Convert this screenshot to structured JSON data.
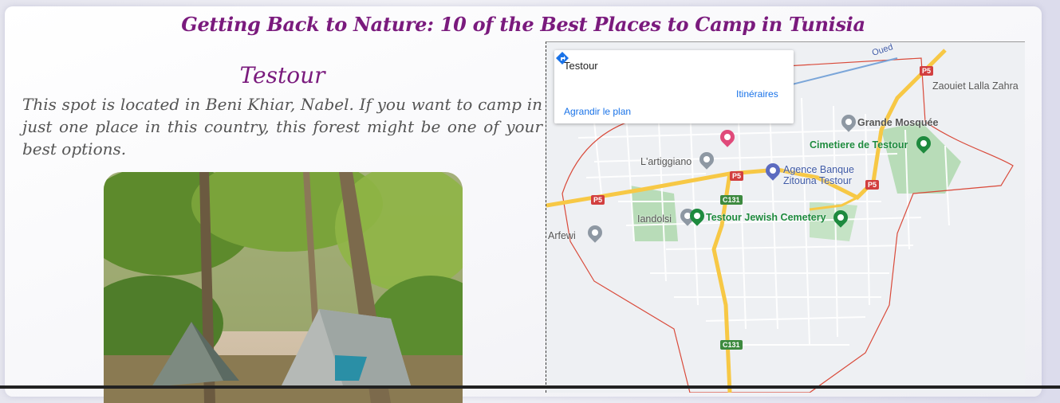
{
  "page": {
    "title": "Getting Back to Nature: 10 of the Best Places to Camp in Tunisia"
  },
  "section": {
    "place_name": "Testour",
    "description": "This spot is located in Beni Khiar, Nabel. If you want to camp in just one place in this country, this forest might be one of your best options."
  },
  "map": {
    "infobox": {
      "title": "Testour",
      "directions_label": "Itinéraires",
      "enlarge_label": "Agrandir le plan"
    },
    "labels": {
      "zaouiet": "Zaouiet Lalla Zahra",
      "mosque": "Grande Mosquée",
      "cemetery": "Cimetiere de Testour",
      "artiggiano": "L'artiggiano",
      "bank_line1": "Agence Banque",
      "bank_line2": "Zitouna Testour",
      "iandolsi": "Iandolsi",
      "jewish_cemetery": "Testour Jewish Cemetery",
      "arfewi": "Arfewi",
      "river": "Oued"
    },
    "road_shields": {
      "p5": "P5",
      "c131": "C131"
    }
  },
  "colors": {
    "title": "#7a1a7d",
    "link": "#1a73e8",
    "poi_green": "#1e8a3e",
    "road": "#f7c845",
    "boundary": "#d94a3a"
  }
}
